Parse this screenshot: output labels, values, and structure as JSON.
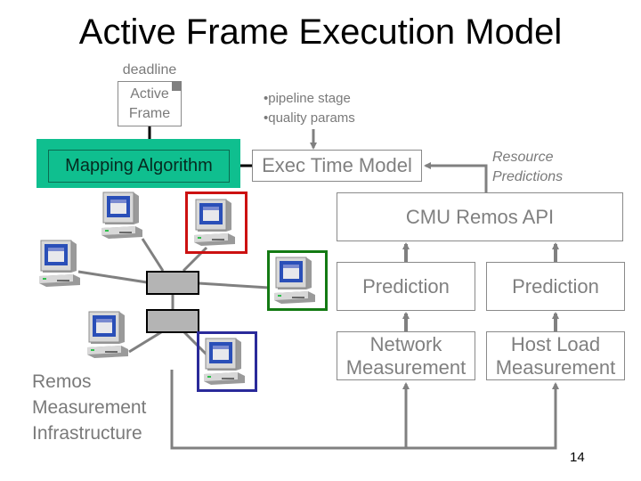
{
  "title": "Active Frame Execution Model",
  "active_frame": {
    "deadline_label": "deadline",
    "line1": "Active",
    "line2": "Frame"
  },
  "mapping_algorithm": "Mapping Algorithm",
  "exec_inputs": [
    "•pipeline stage",
    "•quality params"
  ],
  "exec_time_model": "Exec Time Model",
  "resource_predictions": {
    "line1": "Resource",
    "line2": "Predictions"
  },
  "remos_api": "CMU Remos API",
  "prediction_left": "Prediction",
  "prediction_right": "Prediction",
  "network_measurement": {
    "line1": "Network",
    "line2": "Measurement"
  },
  "host_load_measurement": {
    "line1": "Host Load",
    "line2": "Measurement"
  },
  "infrastructure_label": {
    "line1": "Remos",
    "line2": "Measurement",
    "line3": "Infrastructure"
  },
  "page_number": "14",
  "colors": {
    "mapping_bg": "#0fbf8f",
    "highlight_red": "#cc1111",
    "highlight_green": "#137a13",
    "highlight_blue": "#2a2a9a",
    "arrow_gray": "#808080"
  },
  "network_icons": [
    "computer-icon",
    "computer-icon",
    "computer-icon",
    "computer-icon",
    "computer-icon",
    "computer-icon"
  ]
}
